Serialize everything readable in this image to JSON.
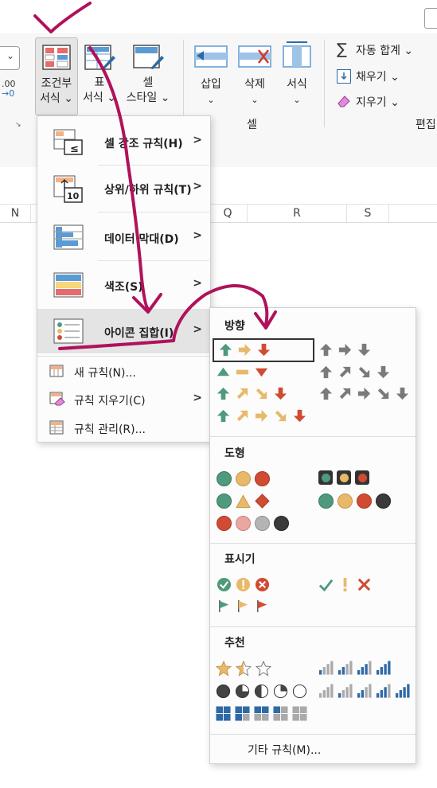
{
  "ribbon": {
    "conditional_format": "조건부\n서식 ⌄",
    "cf_line1": "조건부",
    "cf_line2": "서식 ⌄",
    "table_line1": "표",
    "table_line2": "서식 ⌄",
    "cellstyle_line1": "셀",
    "cellstyle_line2": "스타일 ⌄",
    "insert": "삽입",
    "delete": "삭제",
    "format": "서식",
    "cells_group": "셀",
    "autosum": "자동 합계 ⌄",
    "fill": "채우기 ⌄",
    "clear": "지우기 ⌄",
    "editing_group": "편집",
    "dec_label": ".00",
    "dec_label2": "→0"
  },
  "grid": {
    "columns": [
      "N",
      "Q",
      "R",
      "S"
    ]
  },
  "cf_menu": {
    "items": [
      {
        "label": "셀 강조 규칙(H)"
      },
      {
        "label": "상위/하위 규칙(T)"
      },
      {
        "label": "데이터 막대(D)"
      },
      {
        "label": "색조(S)"
      },
      {
        "label": "아이콘 집합(I)"
      }
    ],
    "new_rule": "새 규칙(N)...",
    "clear_rules": "규칙 지우기(C)",
    "manage_rules": "규칙 관리(R)..."
  },
  "icon_menu": {
    "sections": [
      "방향",
      "도형",
      "표시기",
      "추천"
    ],
    "more_rules": "기타 규칙(M)..."
  },
  "colors": {
    "green": "#4f9a7c",
    "yellow": "#e8b96a",
    "red": "#cf4b32",
    "gray": "#7a7a7a",
    "annotation": "#b0125a"
  }
}
